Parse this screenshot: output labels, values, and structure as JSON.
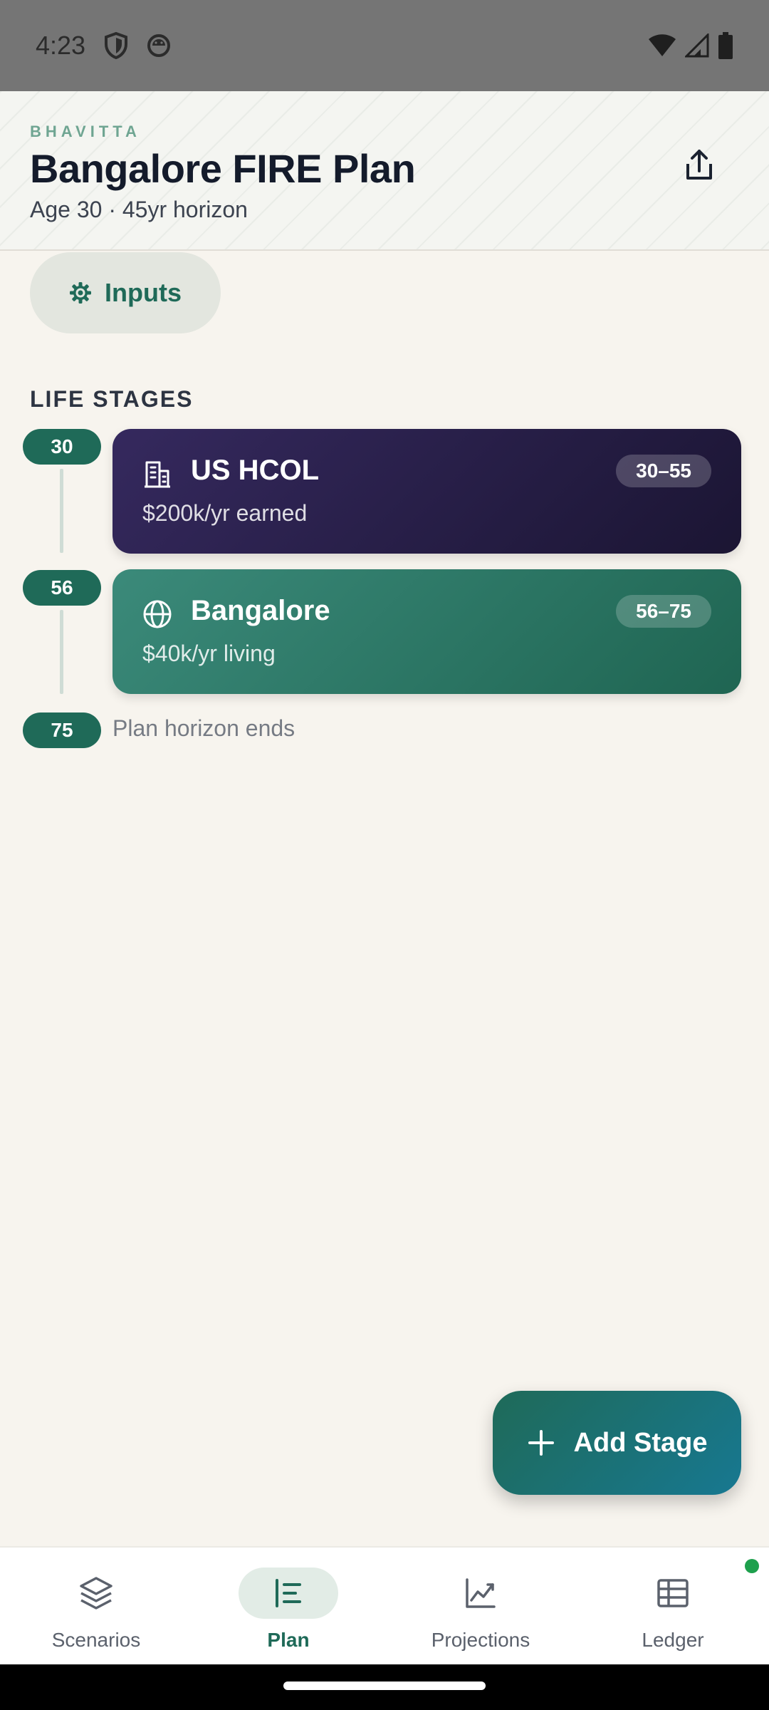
{
  "status_bar": {
    "time": "4:23",
    "icons": [
      "shield-icon",
      "android-head-icon",
      "wifi-icon",
      "signal-icon",
      "battery-icon"
    ]
  },
  "header": {
    "brand": "BHAVITTA",
    "title": "Bangalore FIRE Plan",
    "subtitle": "Age 30 · 45yr horizon",
    "share_icon": "share-icon"
  },
  "inputs_button": {
    "label": "Inputs",
    "icon": "gear-icon"
  },
  "section_label": "LIFE STAGES",
  "stages": [
    {
      "age": "30",
      "name": "US HCOL",
      "detail": "$200k/yr earned",
      "range": "30–55",
      "icon": "building-icon",
      "color": "#2a2049"
    },
    {
      "age": "56",
      "name": "Bangalore",
      "detail": "$40k/yr living",
      "range": "56–75",
      "icon": "globe-icon",
      "color": "#2d7a68"
    }
  ],
  "horizon": {
    "age": "75",
    "text": "Plan horizon ends"
  },
  "fab": {
    "label": "Add Stage",
    "icon": "plus-icon"
  },
  "nav": {
    "items": [
      {
        "label": "Scenarios",
        "icon": "layers-icon"
      },
      {
        "label": "Plan",
        "icon": "timeline-icon",
        "active": true
      },
      {
        "label": "Projections",
        "icon": "trending-chart-icon"
      },
      {
        "label": "Ledger",
        "icon": "table-icon"
      }
    ]
  },
  "colors": {
    "accent": "#1f6a58",
    "background": "#f7f4ee",
    "notification_dot": "#1ea04d"
  }
}
